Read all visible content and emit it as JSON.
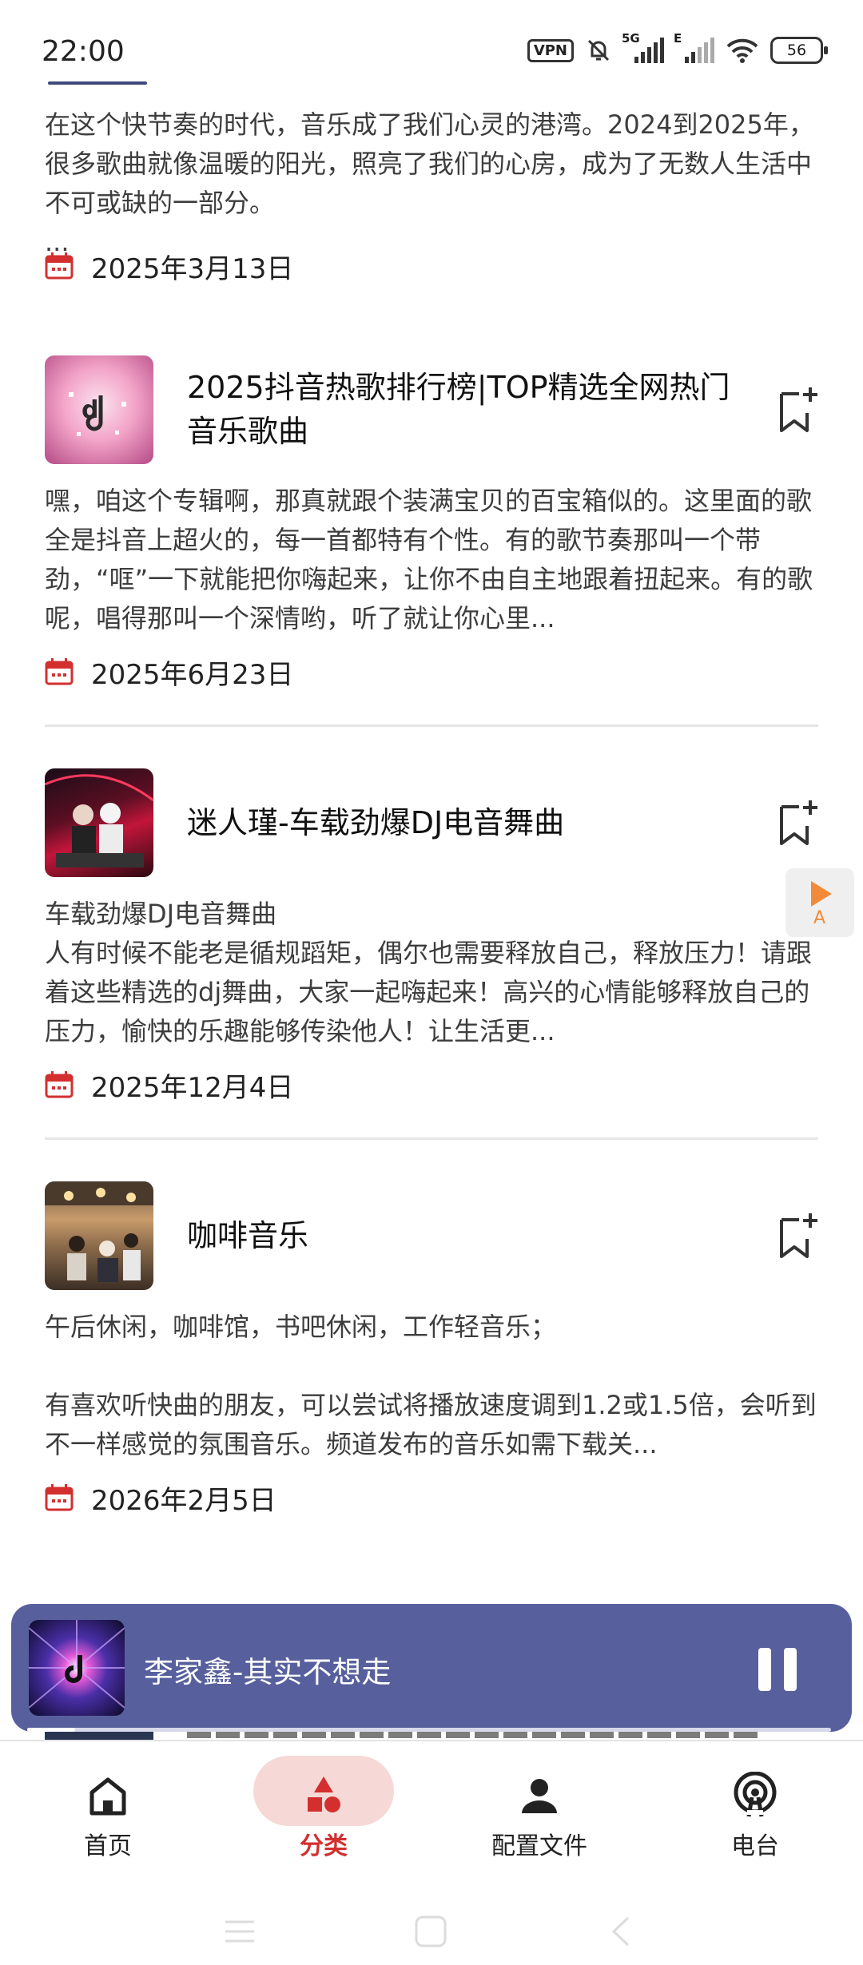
{
  "status_bar": {
    "time": "22:00",
    "vpn_label": "VPN",
    "sim1_label": "5G",
    "sim2_label": "E",
    "battery": "56"
  },
  "feed": [
    {
      "description": "在这个快节奏的时代，音乐成了我们心灵的港湾。2024到2025年，很多歌曲就像温暖的阳光，照亮了我们的心房，成为了无数人生活中不可或缺的一部分。\n...",
      "date": "2025年3月13日"
    },
    {
      "title": "2025抖音热歌排行榜|TOP精选全网热门音乐歌曲",
      "description": "嘿，咱这个专辑啊，那真就跟个装满宝贝的百宝箱似的。这里面的歌全是抖音上超火的，每一首都特有个性。有的歌节奏那叫一个带劲，“哐”一下就能把你嗨起来，让你不由自主地跟着扭起来。有的歌呢，唱得那叫一个深情哟，听了就让你心里...",
      "date": "2025年6月23日"
    },
    {
      "title": "迷人瑾-车载劲爆DJ电音舞曲",
      "description": "车载劲爆DJ电音舞曲\n人有时候不能老是循规蹈矩，偶尔也需要释放自己，释放压力！请跟着这些精选的dj舞曲，大家一起嗨起来！高兴的心情能够释放自己的压力，愉快的乐趣能够传染他人！让生活更...",
      "date": "2025年12月4日"
    },
    {
      "title": "咖啡音乐",
      "description": "午后休闲，咖啡馆，书吧休闲，工作轻音乐；\n\n有喜欢听快曲的朋友，可以尝试将播放速度调到1.2或1.5倍，会听到不一样感觉的氛围音乐。频道发布的音乐如需下载关...",
      "date": "2026年2月5日"
    }
  ],
  "floating_button": {
    "label": "A"
  },
  "player": {
    "title": "李家鑫-其实不想走",
    "progress": 0.06
  },
  "nav": {
    "items": [
      {
        "label": "首页",
        "icon": "home-icon"
      },
      {
        "label": "分类",
        "icon": "category-icon",
        "active": true
      },
      {
        "label": "配置文件",
        "icon": "profile-icon"
      },
      {
        "label": "电台",
        "icon": "radio-icon"
      }
    ]
  },
  "colors": {
    "accent": "#d32f2f",
    "player_bg": "#57609d",
    "active_pill": "#f6d9d6",
    "divider": "#e6e6e6"
  }
}
